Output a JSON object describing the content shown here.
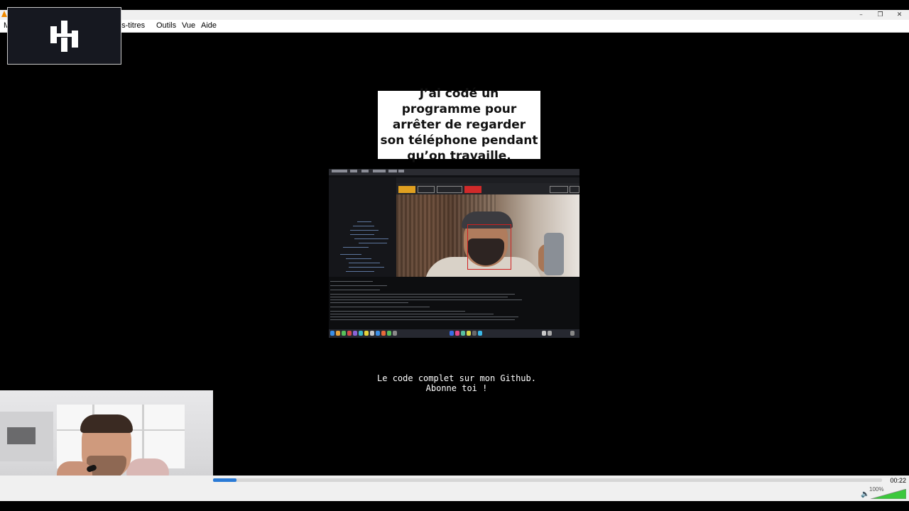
{
  "window": {
    "min_glyph": "–",
    "max_glyph": "❐",
    "close_glyph": "✕"
  },
  "menu": {
    "items": [
      {
        "label": "M"
      },
      {
        "label": "us-titres"
      },
      {
        "label": "Outils"
      },
      {
        "label": "Vue"
      },
      {
        "label": "Aide"
      }
    ]
  },
  "video": {
    "caption": "J’ai codé un programme pour arrêter de regarder son téléphone pendant qu’on travaille.",
    "subtitle_line1": "Le code complet sur mon Github.",
    "subtitle_line2": "Abonne toi !"
  },
  "playback": {
    "elapsed_time": "00:22",
    "progress_fraction": 0.035,
    "volume_label": "100%",
    "volume_level": 1.0
  },
  "colors": {
    "accent": "#2a7ad6",
    "volume": "#3cc83c",
    "logo_bg": "#161820",
    "vlc_orange": "#f08a00"
  },
  "icons": {
    "app": "vlc-cone-icon",
    "logo": "brand-logo-icon",
    "volume": "speaker-icon"
  }
}
